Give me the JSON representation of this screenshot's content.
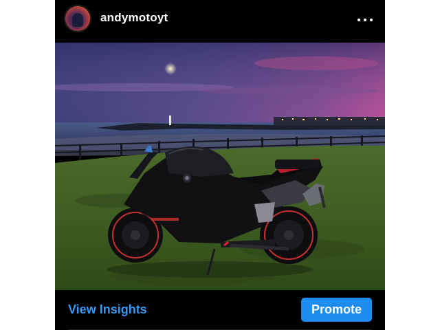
{
  "post": {
    "username": "andymotoyt",
    "more_icon": "more-horizontal-icon",
    "photo_description_icon": "motorcycle-photo"
  },
  "footer": {
    "insights_label": "View Insights",
    "promote_label": "Promote"
  },
  "colors": {
    "accent": "#3897f0",
    "button": "#1d8cf1",
    "background": "#000000"
  }
}
